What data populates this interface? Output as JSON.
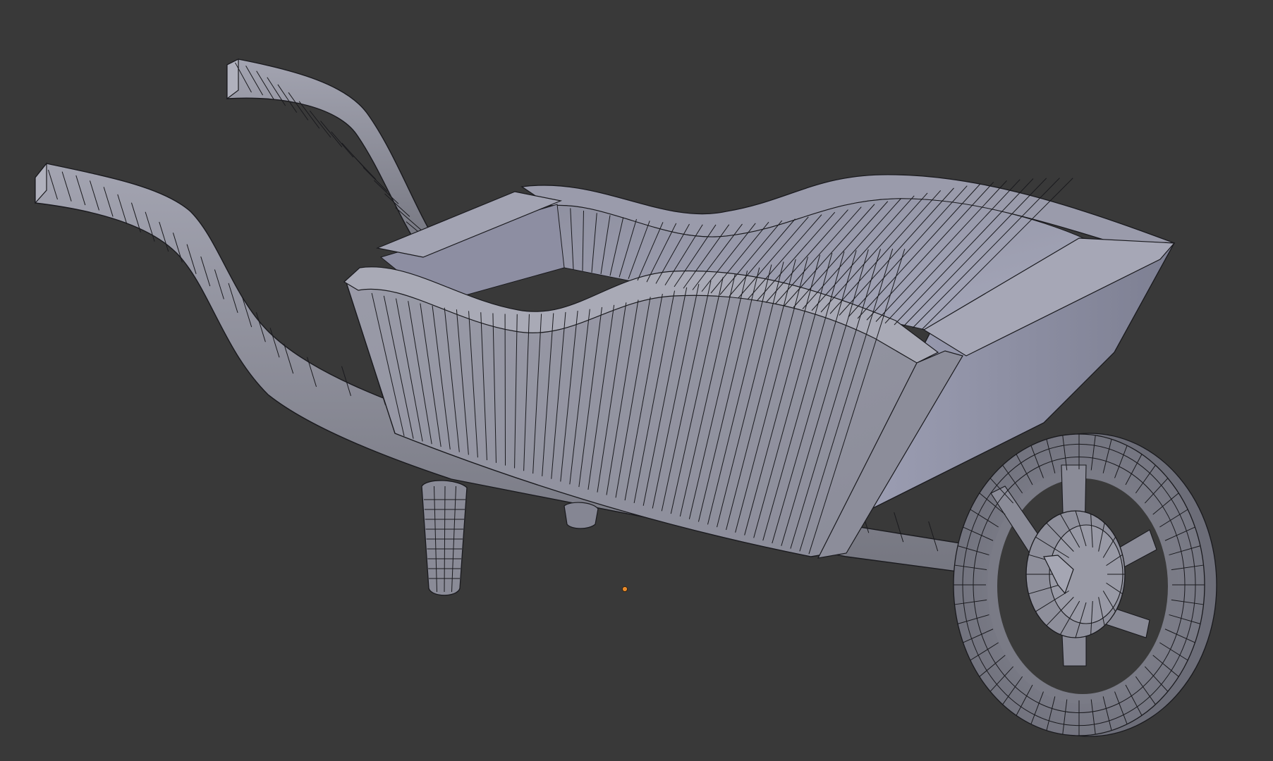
{
  "viewport": {
    "background_color": "#393939",
    "mesh_base_color": "#8e8f9c",
    "mesh_light_color": "#a7a8b6",
    "mesh_dark_color": "#6c6d79",
    "wire_color": "#1a1a1e",
    "origin_color": "#e88a2a"
  },
  "object": {
    "icon": "wheelbarrow-mesh"
  }
}
